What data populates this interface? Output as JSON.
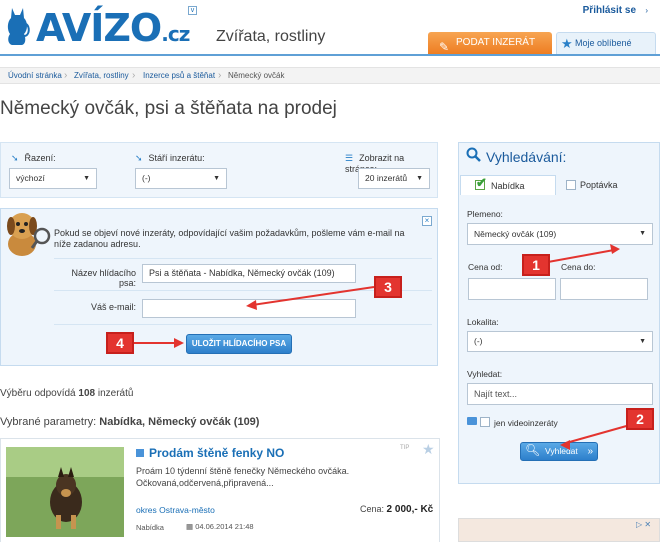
{
  "header": {
    "logo_main": "AVÍZO",
    "logo_suffix": ".cz",
    "category_tagline": "Zvířata, rostliny",
    "login_label": "Přihlásit se",
    "post_ad_button": "PODAT INZERÁT",
    "favorites_button": "Moje oblíbené"
  },
  "breadcrumb": [
    "Úvodní stránka",
    "Zvířata, rostliny",
    "Inzerce psů a štěňat",
    "Německý ovčák"
  ],
  "page_title": "Německý ovčák, psi a štěňata na prodej",
  "filters": {
    "sort_label": "Řazení:",
    "sort_value": "výchozí",
    "age_label": "Stáří inzerátu:",
    "age_value": "(-)",
    "per_page_label": "Zobrazit na stránce:",
    "per_page_value": "20 inzerátů"
  },
  "watchdog": {
    "info_text": "Pokud se objeví nové inzeráty, odpovídající vašim požadavkům, pošleme vám e-mail na níže zadanou adresu.",
    "name_label": "Název hlídacího psa:",
    "name_value": "Psi a štěňata - Nabídka, Německý ovčák (109)",
    "email_label": "Váš e-mail:",
    "email_value": "",
    "save_button": "ULOŽIT HLÍDACÍHO PSA",
    "close_icon": "×"
  },
  "results": {
    "count_prefix": "Výběru odpovídá",
    "count": "108",
    "count_suffix": "inzerátů",
    "params_label": "Vybrané parametry:",
    "params_value": "Nabídka, Německý ovčák (109)"
  },
  "listing": {
    "title": "Prodám štěně fenky NO",
    "description": "Proám 10 týdenní štěně fenečky Německého ovčáka. Očkovaná,odčervená,připravená...",
    "location": "okres Ostrava-město",
    "price_label": "Cena:",
    "price_value": "2 000,- Kč",
    "type": "Nabídka",
    "date": "04.06.2014 21:48",
    "top_label": "TIP"
  },
  "search": {
    "title": "Vyhledávání:",
    "tab_offer": "Nabídka",
    "tab_demand": "Poptávka",
    "breed_label": "Plemeno:",
    "breed_value": "Německý ovčák (109)",
    "price_from_label": "Cena od:",
    "price_to_label": "Cena do:",
    "price_from_value": "",
    "price_to_value": "",
    "locality_label": "Lokalita:",
    "locality_value": "(-)",
    "query_label": "Vyhledat:",
    "query_placeholder": "Najít text...",
    "video_label": "jen videoinzeráty",
    "submit_button": "Vyhledat"
  },
  "annotations": [
    "1",
    "2",
    "3",
    "4"
  ],
  "colors": {
    "brand_blue": "#1a6fb6",
    "accent_orange": "#ee7d22",
    "panel_bg": "#eef5fc",
    "badge_red": "#e3342f"
  }
}
